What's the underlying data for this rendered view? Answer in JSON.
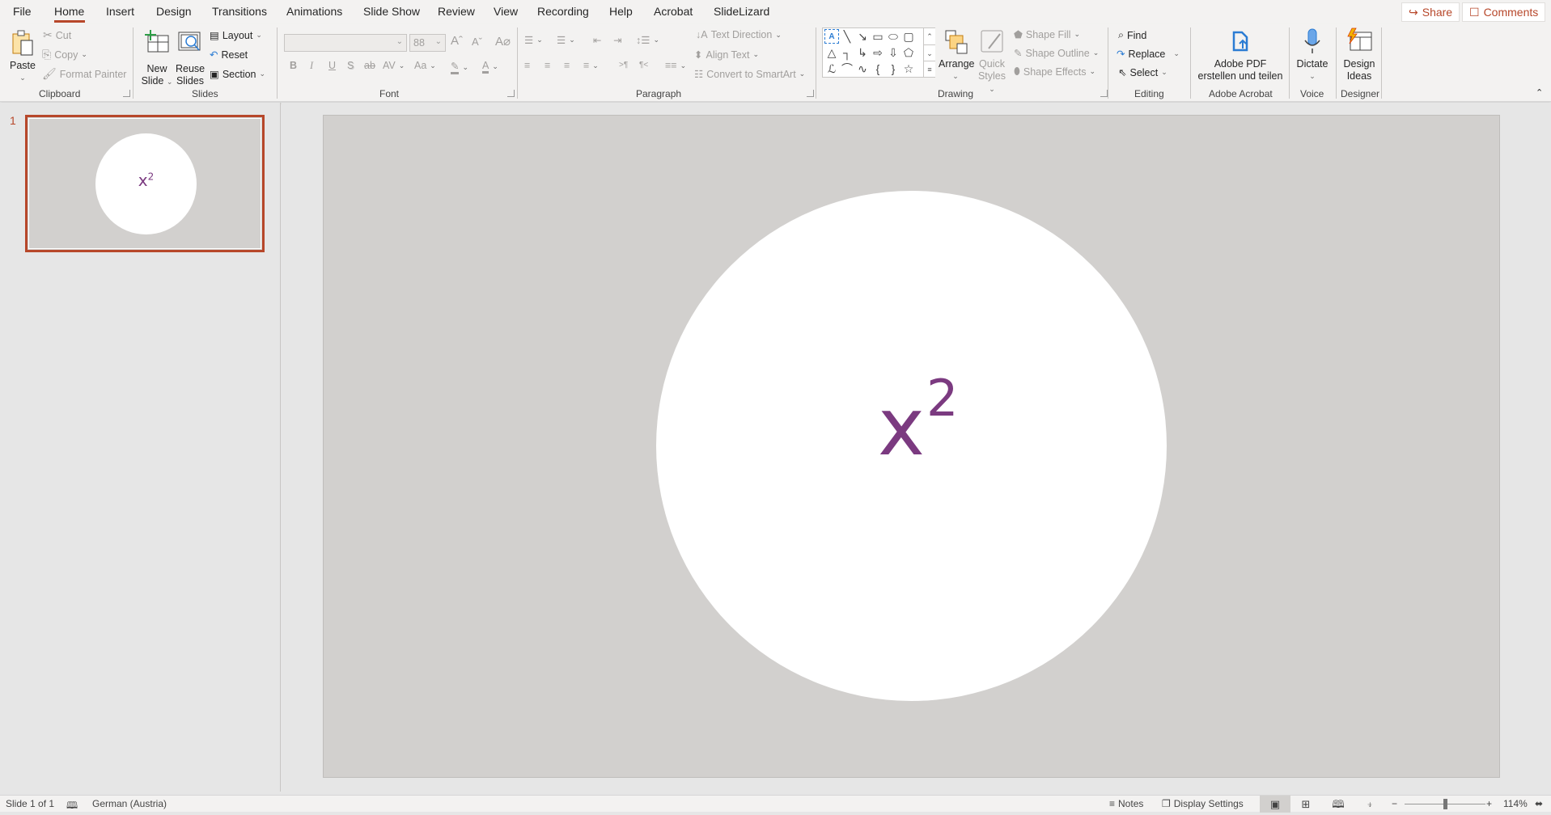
{
  "tabs": [
    {
      "label": "File",
      "active": false
    },
    {
      "label": "Home",
      "active": true
    },
    {
      "label": "Insert",
      "active": false
    },
    {
      "label": "Design",
      "active": false
    },
    {
      "label": "Transitions",
      "active": false
    },
    {
      "label": "Animations",
      "active": false
    },
    {
      "label": "Slide Show",
      "active": false
    },
    {
      "label": "Review",
      "active": false
    },
    {
      "label": "View",
      "active": false
    },
    {
      "label": "Recording",
      "active": false
    },
    {
      "label": "Help",
      "active": false
    },
    {
      "label": "Acrobat",
      "active": false
    },
    {
      "label": "SlideLizard",
      "active": false
    }
  ],
  "top_actions": {
    "share": {
      "label": "Share",
      "icon": "share-icon"
    },
    "comments": {
      "label": "Comments",
      "icon": "comment-icon"
    }
  },
  "ribbon": {
    "clipboard": {
      "label": "Clipboard",
      "paste": "Paste",
      "cut": "Cut",
      "copy": "Copy",
      "format_painter": "Format Painter"
    },
    "slides": {
      "label": "Slides",
      "new_slide": [
        "New",
        "Slide"
      ],
      "reuse_slides": [
        "Reuse",
        "Slides"
      ],
      "layout": "Layout",
      "reset": "Reset",
      "section": "Section"
    },
    "font": {
      "label": "Font",
      "font_name": "",
      "font_size": "88",
      "buttons": [
        "B",
        "I",
        "U",
        "S",
        "ab",
        "AV",
        "Aa"
      ]
    },
    "paragraph": {
      "label": "Paragraph",
      "text_direction": "Text Direction",
      "align_text": "Align Text",
      "convert_smartart": "Convert to SmartArt"
    },
    "drawing": {
      "label": "Drawing",
      "arrange": "Arrange",
      "quick_styles": [
        "Quick",
        "Styles"
      ],
      "shape_fill": "Shape Fill",
      "shape_outline": "Shape Outline",
      "shape_effects": "Shape Effects"
    },
    "editing": {
      "label": "Editing",
      "find": "Find",
      "replace": "Replace",
      "select": "Select"
    },
    "acrobat": {
      "label": "Adobe Acrobat",
      "button": [
        "Adobe PDF",
        "erstellen und teilen"
      ]
    },
    "voice": {
      "label": "Voice",
      "dictate": "Dictate"
    },
    "designer": {
      "label": "Designer",
      "design_ideas": [
        "Design",
        "Ideas"
      ]
    }
  },
  "thumbnails": [
    {
      "number": "1",
      "equation_base": "x",
      "equation_exp": "2",
      "selected": true
    }
  ],
  "slide": {
    "background": "#d2d0ce",
    "shape": "circle",
    "shape_fill": "#ffffff",
    "equation_base": "x",
    "equation_exp": "2",
    "equation_color": "#7b3a80"
  },
  "statusbar": {
    "slide_info": "Slide 1 of 1",
    "language": "German (Austria)",
    "notes": "Notes",
    "display_settings": "Display Settings",
    "zoom_minus": "−",
    "zoom_plus": "+",
    "zoom_level": "114%"
  },
  "colors": {
    "accent": "#b7472a",
    "equation": "#7b3a80"
  }
}
